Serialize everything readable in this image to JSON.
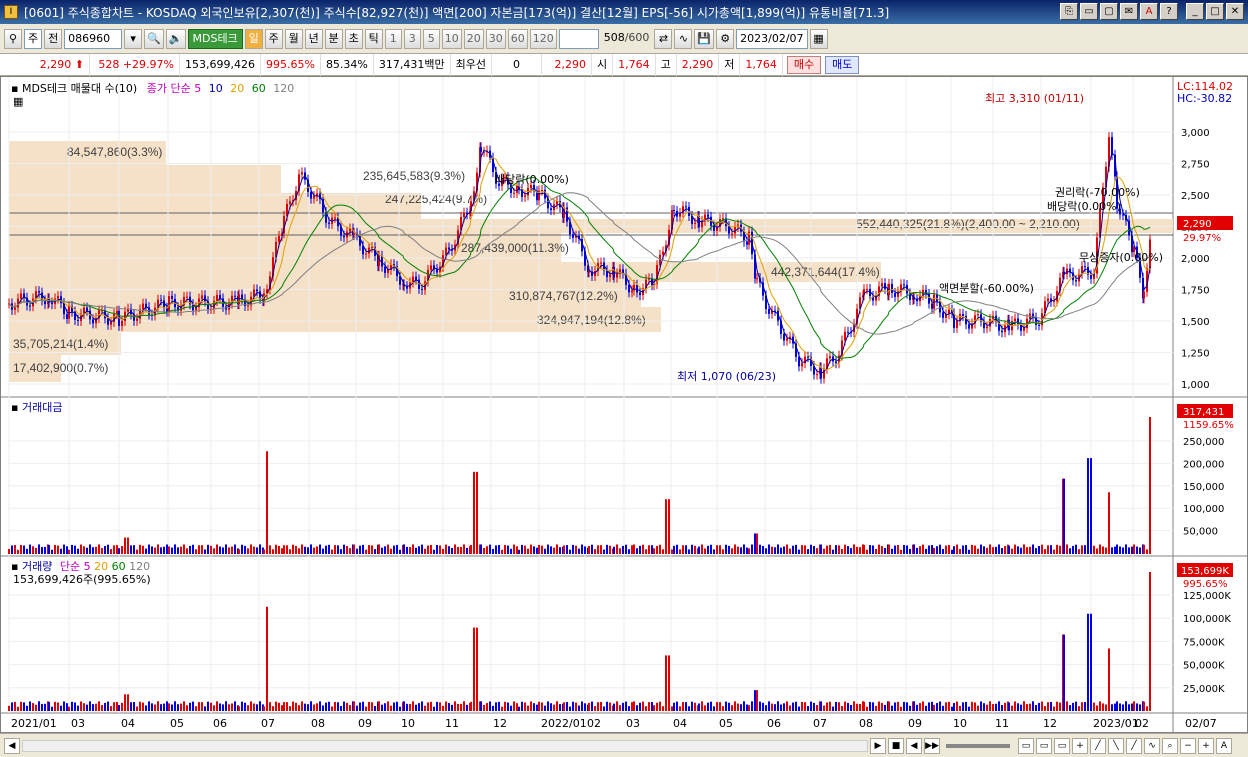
{
  "window": {
    "title": "[0601] 주식종합차트 - KOSDAQ 외국인보유[2,307(천)] 주식수[82,927(천)] 액면[200] 자본금[173(억)] 결산[12월] EPS[-56] 시가총액[1,899(억)] 유통비율[71.3]"
  },
  "toolbar": {
    "market": "주",
    "prev_label": "전",
    "code": "086960",
    "stock_name": "MDS테크",
    "periods": [
      "일",
      "주",
      "월",
      "년",
      "분",
      "초",
      "틱"
    ],
    "active_period": "일",
    "intervals": [
      "1",
      "3",
      "5",
      "10",
      "20",
      "30",
      "60",
      "120"
    ],
    "count": "508",
    "count_total": "/600",
    "date": "2023/02/07"
  },
  "quote": {
    "price": "2,290",
    "change": "528",
    "change_pct": "+29.97%",
    "volume": "153,699,426",
    "volume_pct": "995.65%",
    "ratio": "85.34%",
    "amount": "317,431백만",
    "pref_label": "최우선",
    "pref_value": "0",
    "ask": "2,290",
    "open_label": "시",
    "open": "1,764",
    "high_label": "고",
    "high": "2,290",
    "low_label": "저",
    "low": "1,764",
    "buy_label": "매수",
    "sell_label": "매도"
  },
  "panels": {
    "price": {
      "label": "MDS테크 매물대 수(10)",
      "ma_label": "종가 단순",
      "ma_periods": [
        "5",
        "10",
        "20",
        "60",
        "120"
      ],
      "lc": "LC:114.02",
      "hc": "HC:-30.82",
      "current_price_tag": "2,290",
      "current_pct_tag": "29.97%",
      "y_ticks": [
        "3,000",
        "2,750",
        "2,500",
        "2,250",
        "2,000",
        "1,750",
        "1,500",
        "1,250",
        "1,000"
      ],
      "annotations": {
        "high": "최고 3,310 (01/11)",
        "low": "최저 1,070 (06/23)",
        "dividend1": "배당락(0.00%)",
        "rights": "권리락(-70.00%)",
        "dividend2": "배당락(0.00%)",
        "capital": "무상증자(0.00%)",
        "split": "액면분할(-60.00%)"
      },
      "volume_profile": [
        {
          "label": "84,547,860(3.3%)"
        },
        {
          "label": "235,645,583(9.3%)"
        },
        {
          "label": "247,225,424(9.7%)"
        },
        {
          "label": "552,440,325(21.8%)(2,400.00 ~ 2,210.00)"
        },
        {
          "label": "287,439,000(11.3%)"
        },
        {
          "label": "442,371,644(17.4%)"
        },
        {
          "label": "310,874,767(12.2%)"
        },
        {
          "label": "324,947,194(12.8%)"
        },
        {
          "label": "35,705,214(1.4%)"
        },
        {
          "label": "17,402,900(0.7%)"
        }
      ]
    },
    "amount": {
      "label": "거래대금",
      "tag": "317,431",
      "tag_pct": "1159.65%",
      "y_ticks": [
        "250,000",
        "200,000",
        "150,000",
        "100,000",
        "50,000"
      ]
    },
    "volume": {
      "label": "거래량",
      "ma_label": "단순",
      "ma_periods": [
        "5",
        "20",
        "60",
        "120"
      ],
      "value": "153,699,426주(995.65%)",
      "tag": "153,699K",
      "tag_pct": "995.65%",
      "y_ticks": [
        "125,000K",
        "100,000K",
        "75,000K",
        "50,000K",
        "25,000K"
      ]
    }
  },
  "x_axis": {
    "labels": [
      "2021/01",
      "03",
      "04",
      "05",
      "06",
      "07",
      "08",
      "09",
      "10",
      "11",
      "12",
      "2022/01",
      "02",
      "03",
      "04",
      "05",
      "06",
      "07",
      "08",
      "09",
      "10",
      "11",
      "12",
      "2023/01",
      "02",
      "02/07"
    ]
  },
  "colors": {
    "up": "#e00000",
    "down": "#0000e0",
    "ma5": "#e000e0",
    "ma10": "#0000a0",
    "ma20": "#e0a000",
    "ma60": "#008000",
    "ma120": "#808080",
    "profile": "#f5e0c8"
  }
}
